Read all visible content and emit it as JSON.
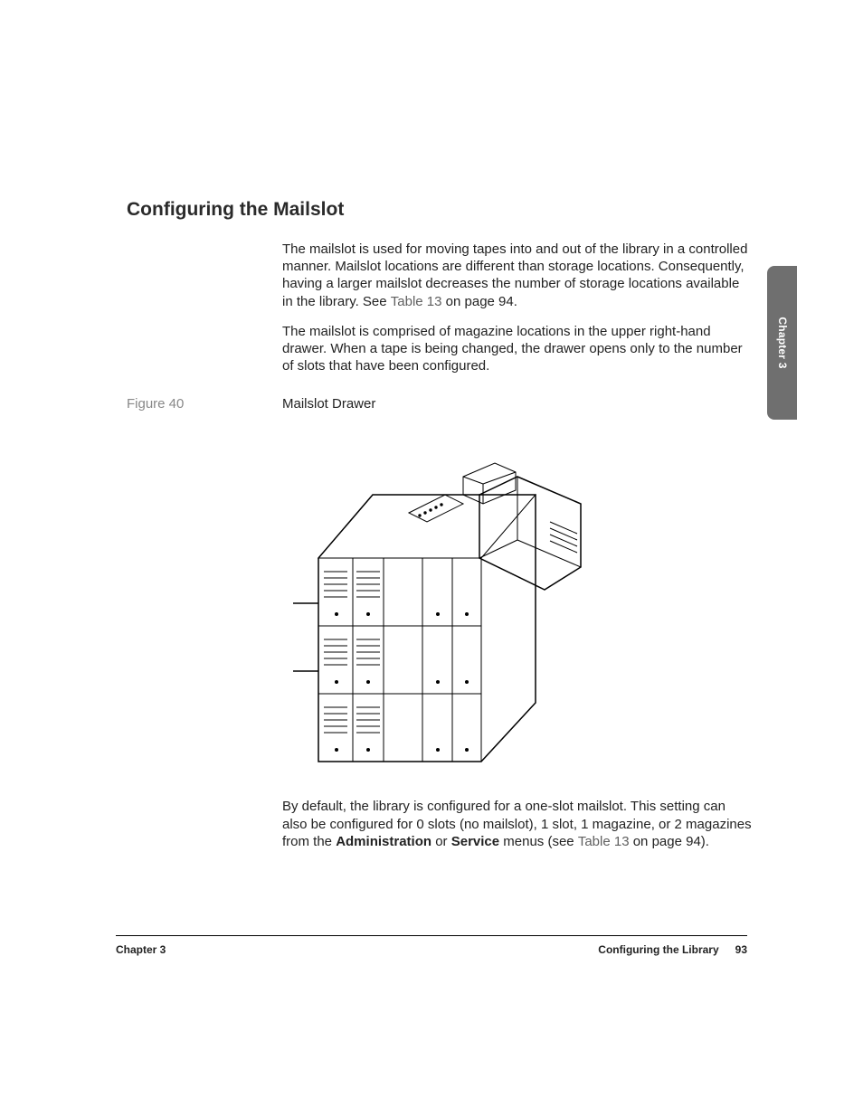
{
  "sideTab": "Chapter 3",
  "section": {
    "title": "Configuring the Mailslot",
    "para1_a": "The mailslot is used for moving tapes into and out of the library in a controlled manner. Mailslot locations are different than storage locations. Consequently, having a larger mailslot decreases the number of storage locations available in the library. See ",
    "para1_link": "Table 13",
    "para1_b": "  on page 94.",
    "para2": "The mailslot is comprised of magazine locations in the upper right-hand drawer. When a tape is being changed, the drawer opens only to the number of slots that have been configured.",
    "figure_label": "Figure 40",
    "figure_caption": "Mailslot Drawer",
    "para3_a": "By default, the library is configured for a one-slot mailslot. This setting can also be configured for 0 slots (no mailslot), 1 slot, 1 magazine, or 2 magazines from the ",
    "para3_b1": "Administration",
    "para3_b2": " or ",
    "para3_b3": "Service",
    "para3_b4": " menus (see ",
    "para3_link": "Table 13",
    "para3_c": "  on page 94)."
  },
  "footer": {
    "left": "Chapter 3",
    "rightTitle": "Configuring the Library",
    "pageNumber": "93"
  }
}
